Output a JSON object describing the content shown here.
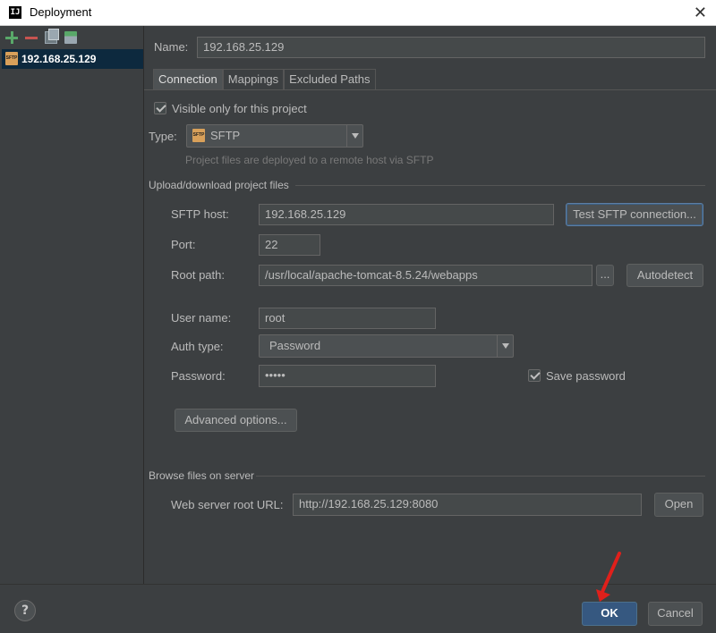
{
  "window": {
    "title": "Deployment",
    "app_icon": "IJ",
    "close_glyph": "✕"
  },
  "left": {
    "toolbar_icons": [
      "plus-icon",
      "minus-icon",
      "copy-icon",
      "default-server-icon"
    ],
    "servers": [
      {
        "label": "192.168.25.129",
        "type_icon": "SFTP"
      }
    ]
  },
  "name": {
    "label": "Name:",
    "value": "192.168.25.129"
  },
  "tabs": [
    {
      "label": "Connection"
    },
    {
      "label": "Mappings"
    },
    {
      "label": "Excluded Paths"
    }
  ],
  "connection": {
    "visible_only_label": "Visible only for this project",
    "type_label": "Type:",
    "type_value": "SFTP",
    "type_icon_text": "SFTP",
    "type_hint": "Project files are deployed to a remote host via SFTP",
    "upload_section": "Upload/download project files",
    "host_label": "SFTP host:",
    "host_value": "192.168.25.129",
    "test_button": "Test SFTP connection...",
    "port_label": "Port:",
    "port_value": "22",
    "root_label": "Root path:",
    "root_value": "/usr/local/apache-tomcat-8.5.24/webapps",
    "browse_button": "...",
    "autodetect_button": "Autodetect",
    "user_label": "User name:",
    "user_value": "root",
    "auth_label": "Auth type:",
    "auth_value": "Password",
    "password_label": "Password:",
    "password_value": "•••••",
    "save_password_label": "Save password",
    "advanced_button": "Advanced options...",
    "browse_section": "Browse files on server",
    "web_root_label": "Web server root URL:",
    "web_root_value": "http://192.168.25.129:8080",
    "open_button": "Open"
  },
  "footer": {
    "help": "?",
    "ok": "OK",
    "cancel": "Cancel"
  },
  "colors": {
    "background": "#3c3f41",
    "selection": "#0d293e",
    "primary_button": "#365880",
    "annotation_arrow": "#e0201b"
  }
}
